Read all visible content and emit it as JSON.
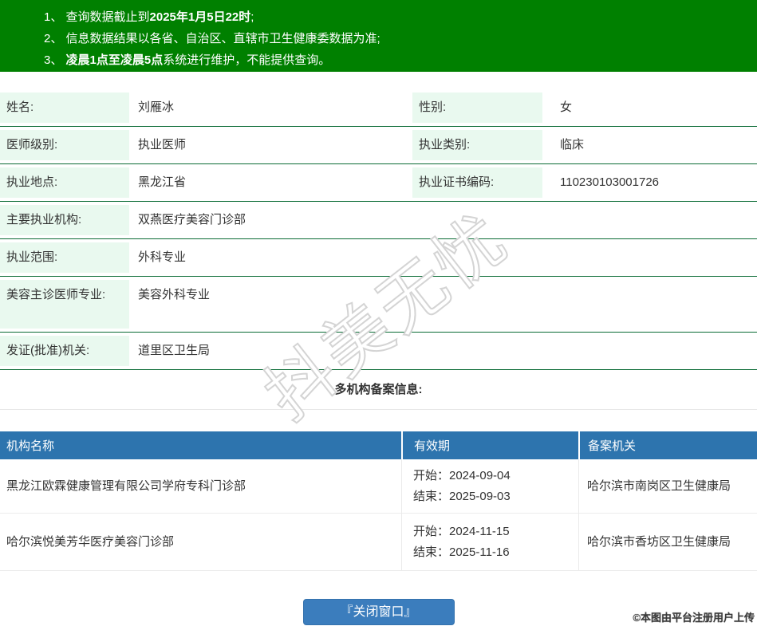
{
  "banner": {
    "bg_color": "#008000",
    "notices": [
      {
        "pre": "1、 查询数据截止到",
        "bold": "2025年1月5日22时",
        "post": ";"
      },
      {
        "pre": "2、 信息数据结果以各省、自治区、直辖市卫生健康委数据为准;",
        "bold": "",
        "post": ""
      },
      {
        "pre": "3、 ",
        "bold": "凌晨1点至凌晨5点",
        "post": "系统进行维护，不能提供查询。"
      }
    ]
  },
  "doctor": {
    "pair_rows": [
      {
        "label1": "姓名:",
        "value1": "刘雁冰",
        "label2": "性别:",
        "value2": "女"
      },
      {
        "label1": "医师级别:",
        "value1": "执业医师",
        "label2": "执业类别:",
        "value2": "临床"
      },
      {
        "label1": "执业地点:",
        "value1": "黑龙江省",
        "label2": "执业证书编码:",
        "value2": "110230103001726"
      }
    ],
    "single_rows": [
      {
        "label": "主要执业机构:",
        "value": "双燕医疗美容门诊部"
      },
      {
        "label": "执业范围:",
        "value": "外科专业"
      },
      {
        "label": "美容主诊医师专业:",
        "value": "美容外科专业"
      },
      {
        "label": "发证(批准)机关:",
        "value": "道里区卫生局"
      }
    ]
  },
  "section": {
    "title": "多机构备案信息:"
  },
  "org_table": {
    "headers": [
      "机构名称",
      "有效期",
      "备案机关"
    ],
    "rows": [
      {
        "org": "黑龙江欧霖健康管理有限公司学府专科门诊部",
        "start": "开始：2024-09-04",
        "end": "结束：2025-09-03",
        "authority": "哈尔滨市南岗区卫生健康局"
      },
      {
        "org": "哈尔滨悦美芳华医疗美容门诊部",
        "start": "开始：2024-11-15",
        "end": "结束：2025-11-16",
        "authority": "哈尔滨市香坊区卫生健康局"
      }
    ]
  },
  "button": {
    "label": "『关闭窗口』"
  },
  "watermark": {
    "text": "抖美无忧"
  },
  "footer": {
    "credit": "©本图由平台注册用户上传"
  },
  "colors": {
    "banner_green": "#008000",
    "label_bg_mint": "#e9f9ef",
    "row_border_green": "#0a6b35",
    "table_header_blue": "#2d74ae",
    "button_blue": "#3b7dbd"
  }
}
